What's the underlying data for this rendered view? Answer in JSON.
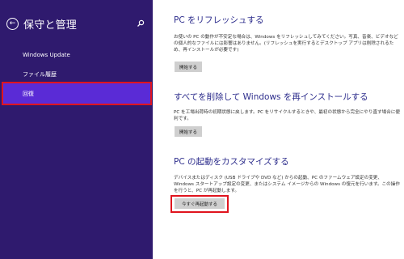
{
  "sidebar": {
    "title": "保守と管理",
    "items": [
      {
        "label": "Windows Update"
      },
      {
        "label": "ファイル履歴"
      },
      {
        "label": "回復"
      }
    ]
  },
  "main": {
    "sections": [
      {
        "title": "PC をリフレッシュする",
        "description": "お使いの PC の動作が不安定な場合は、Windows をリフレッシュしてみてください。写真、音楽、ビデオなどの個人的なファイルには影響はありません。(リフレッシュを実行するとデスクトップ アプリは削除されるため、再インストールが必要です)",
        "button": "開始する"
      },
      {
        "title": "すべてを削除して Windows を再インストールする",
        "description": "PC を工場出荷時の初期状態に戻します。PC をリサイクルするときや、最初の状態から完全にやり直す場合に便利です。",
        "button": "開始する"
      },
      {
        "title": "PC の起動をカスタマイズする",
        "description": "デバイスまたはディスク (USB ドライブや DVD など) からの起動、PC のファームウェア設定の変更、Windows スタートアップ設定の変更、またはシステム イメージからの Windows の復元を行います。この操作を行うと、PC が再起動します。",
        "button": "今すぐ再起動する"
      }
    ]
  },
  "colors": {
    "sidebar_bg": "#2f1a6e",
    "selected_bg": "#5a2bd6",
    "highlight": "#e0141e",
    "heading": "#2d2d8c"
  }
}
